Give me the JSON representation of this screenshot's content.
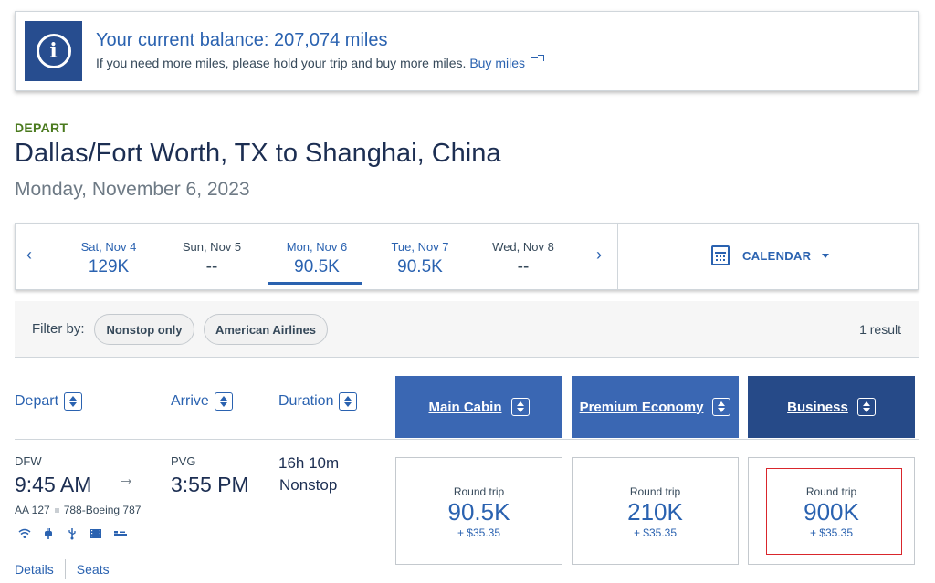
{
  "banner": {
    "title": "Your current balance: 207,074 miles",
    "message": "If you need more miles, please hold your trip and buy more miles.",
    "buy_link": "Buy miles"
  },
  "depart": {
    "label": "DEPART",
    "route": "Dallas/Fort Worth, TX to Shanghai, China",
    "date": "Monday, November 6, 2023"
  },
  "date_bar": {
    "prev": "‹",
    "next": "›",
    "days": [
      {
        "label": "Sat, Nov 4",
        "price": "129K"
      },
      {
        "label": "Sun, Nov 5",
        "price": "--"
      },
      {
        "label": "Mon, Nov 6",
        "price": "90.5K"
      },
      {
        "label": "Tue, Nov 7",
        "price": "90.5K"
      },
      {
        "label": "Wed, Nov 8",
        "price": "--"
      }
    ],
    "calendar_label": "CALENDAR"
  },
  "filters": {
    "label": "Filter by:",
    "chips": [
      "Nonstop only",
      "American Airlines"
    ],
    "results": "1 result"
  },
  "columns": {
    "depart": "Depart",
    "arrive": "Arrive",
    "duration": "Duration",
    "cabins": [
      "Main Cabin",
      "Premium Economy",
      "Business"
    ]
  },
  "flight": {
    "origin": "DFW",
    "depart_time": "9:45 AM",
    "destination": "PVG",
    "arrive_time": "3:55 PM",
    "flight_number": "AA 127",
    "aircraft": "788-Boeing 787",
    "duration": "16h 10m",
    "stops": "Nonstop",
    "details_link": "Details",
    "seats_link": "Seats",
    "amenities": [
      "wifi-icon",
      "power-outlet-icon",
      "usb-icon",
      "entertainment-icon",
      "lie-flat-seat-icon"
    ],
    "fares": [
      {
        "trip": "Round trip",
        "miles": "90.5K",
        "tax": "+ $35.35"
      },
      {
        "trip": "Round trip",
        "miles": "210K",
        "tax": "+ $35.35"
      },
      {
        "trip": "Round trip",
        "miles": "900K",
        "tax": "+ $35.35"
      }
    ]
  },
  "colors": {
    "brand_blue": "#2a62b0",
    "cabin_blue": "#3a67b3",
    "business_blue": "#264a88",
    "highlight_red": "#d9262c"
  }
}
